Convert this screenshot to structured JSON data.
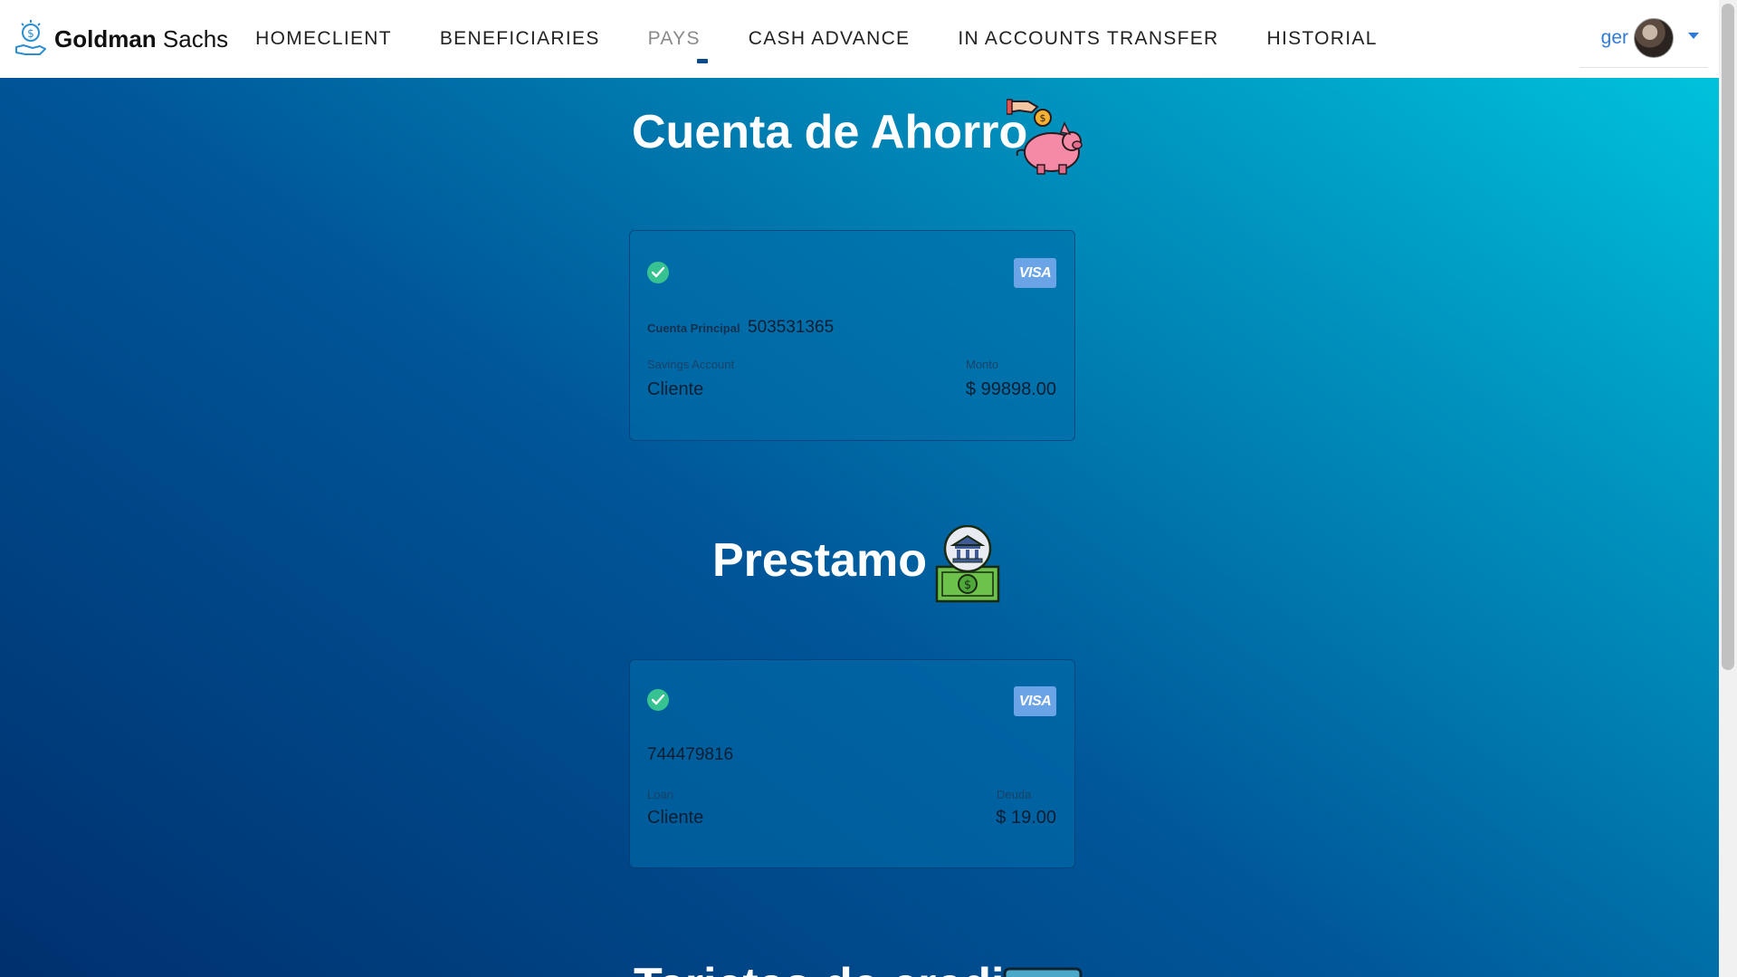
{
  "brand": {
    "name_bold": "Goldman",
    "name_rest": "Sachs",
    "logo_icon": "money-hand-icon"
  },
  "nav": {
    "items": [
      {
        "label": "HOMECLIENT",
        "active": false
      },
      {
        "label": "BENEFICIARIES",
        "active": false
      },
      {
        "label": "PAYS",
        "active": true
      },
      {
        "label": "CASH ADVANCE",
        "active": false
      },
      {
        "label": "IN ACCOUNTS TRANSFER",
        "active": false
      },
      {
        "label": "HISTORIAL",
        "active": false
      }
    ]
  },
  "user": {
    "name": "ger",
    "avatar_icon": "user-avatar-icon",
    "menu_icon": "caret-down-icon"
  },
  "savings": {
    "title": "Cuenta de Ahorro",
    "icon": "piggy-bank-icon",
    "card": {
      "status_icon": "check-circle-icon",
      "brand": "VISA",
      "account_label": "Cuenta Principal",
      "account_number": "503531365",
      "type_label": "Savings Account",
      "type_value": "Cliente",
      "amount_label": "Monto",
      "amount_value": "$ 99898.00"
    }
  },
  "loan": {
    "title": "Prestamo",
    "icon": "bank-money-icon",
    "card": {
      "status_icon": "check-circle-icon",
      "brand": "VISA",
      "account_number": "744479816",
      "type_label": "Loan",
      "type_value": "Cliente",
      "amount_label": "Deuda",
      "amount_value": "$ 19.00"
    }
  },
  "credit": {
    "title": "Tarjetas de credito",
    "icon": "credit-card-icon"
  },
  "colors": {
    "accent": "#2f7bd8",
    "check_green": "#37c391",
    "visa_blue": "#6aa4e6",
    "gradient_dark": "#00306e",
    "gradient_light": "#00c2dc"
  }
}
